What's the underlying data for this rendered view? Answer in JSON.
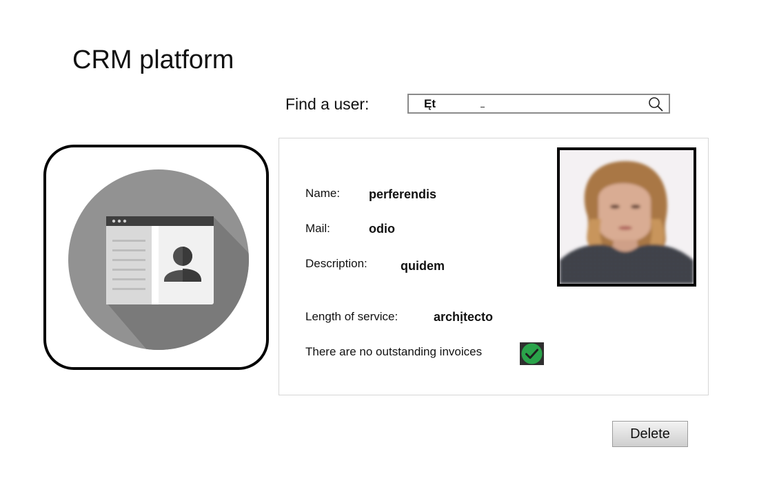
{
  "app": {
    "title": "CRM platform"
  },
  "search": {
    "label": "Find a user:",
    "value": "Ęt",
    "icon": "search-icon"
  },
  "profile": {
    "name_label": "Name:",
    "name_value": "perferendis",
    "mail_label": "Mail:",
    "mail_value": "odio",
    "description_label": "Description:",
    "description_value": "quidem",
    "service_label": "Length of service:",
    "service_value": "archịtecto",
    "invoices_text": "There are no outstanding invoices",
    "invoices_status_icon": "check-circle-icon",
    "photo": "profile-photo"
  },
  "logo": {
    "icon": "contact-card-icon"
  },
  "actions": {
    "delete_label": "Delete"
  },
  "colors": {
    "success": "#2aa34a",
    "logo_circle": "#929292"
  }
}
